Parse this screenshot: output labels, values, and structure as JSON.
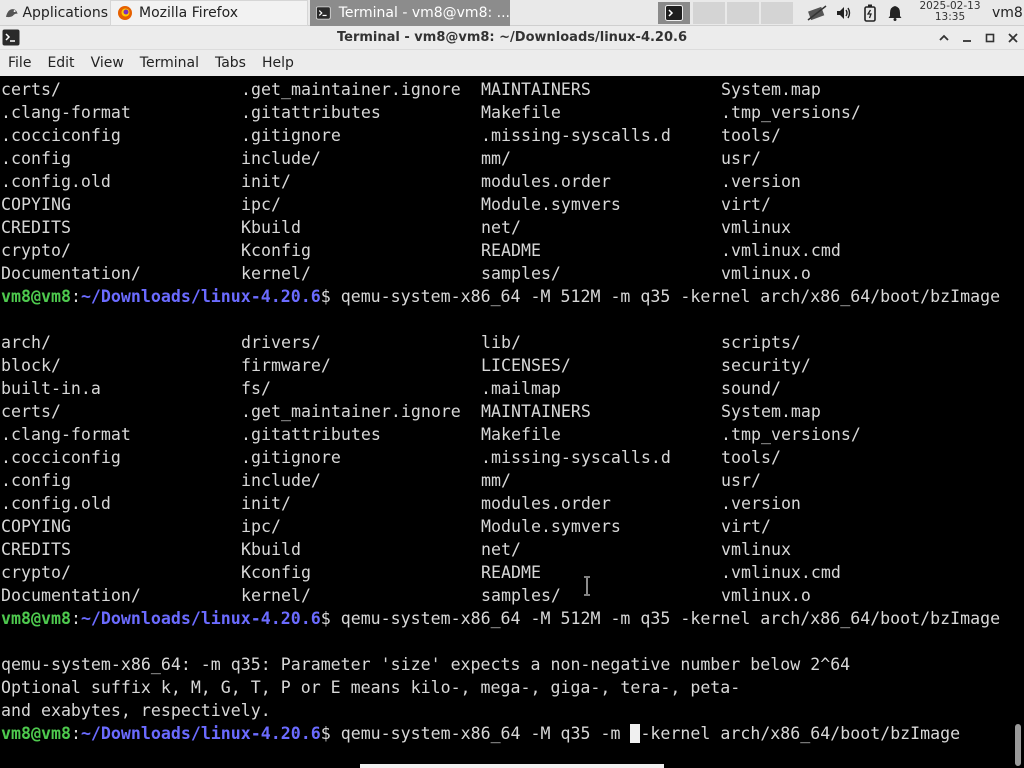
{
  "panel": {
    "applications_label": "Applications",
    "tasks": [
      {
        "label": "Mozilla Firefox",
        "icon": "firefox-icon"
      },
      {
        "label": "Terminal - vm8@vm8: ...",
        "icon": "terminal-icon"
      }
    ],
    "clock_date": "2025-02-13",
    "clock_time": "13:35",
    "user": "vm8"
  },
  "window": {
    "title": "Terminal - vm8@vm8: ~/Downloads/linux-4.20.6"
  },
  "menu": [
    "File",
    "Edit",
    "View",
    "Terminal",
    "Tabs",
    "Help"
  ],
  "prompt": {
    "user": "vm8@vm8",
    "sep": ":",
    "path": "~/Downloads/linux-4.20.6",
    "dollar": "$"
  },
  "terminal": {
    "listing_top": [
      [
        "certs/",
        ".get_maintainer.ignore",
        "MAINTAINERS",
        "System.map"
      ],
      [
        ".clang-format",
        ".gitattributes",
        "Makefile",
        ".tmp_versions/"
      ],
      [
        ".cocciconfig",
        ".gitignore",
        ".missing-syscalls.d",
        "tools/"
      ],
      [
        ".config",
        "include/",
        "mm/",
        "usr/"
      ],
      [
        ".config.old",
        "init/",
        "modules.order",
        ".version"
      ],
      [
        "COPYING",
        "ipc/",
        "Module.symvers",
        "virt/"
      ],
      [
        "CREDITS",
        "Kbuild",
        "net/",
        "vmlinux"
      ],
      [
        "crypto/",
        "Kconfig",
        "README",
        ".vmlinux.cmd"
      ],
      [
        "Documentation/",
        "kernel/",
        "samples/",
        "vmlinux.o"
      ]
    ],
    "cmd1": " qemu-system-x86_64 -M 512M -m q35 -kernel arch/x86_64/boot/bzImage",
    "listing_full": [
      [
        "arch/",
        "drivers/",
        "lib/",
        "scripts/"
      ],
      [
        "block/",
        "firmware/",
        "LICENSES/",
        "security/"
      ],
      [
        "built-in.a",
        "fs/",
        ".mailmap",
        "sound/"
      ],
      [
        "certs/",
        ".get_maintainer.ignore",
        "MAINTAINERS",
        "System.map"
      ],
      [
        ".clang-format",
        ".gitattributes",
        "Makefile",
        ".tmp_versions/"
      ],
      [
        ".cocciconfig",
        ".gitignore",
        ".missing-syscalls.d",
        "tools/"
      ],
      [
        ".config",
        "include/",
        "mm/",
        "usr/"
      ],
      [
        ".config.old",
        "init/",
        "modules.order",
        ".version"
      ],
      [
        "COPYING",
        "ipc/",
        "Module.symvers",
        "virt/"
      ],
      [
        "CREDITS",
        "Kbuild",
        "net/",
        "vmlinux"
      ],
      [
        "crypto/",
        "Kconfig",
        "README",
        ".vmlinux.cmd"
      ],
      [
        "Documentation/",
        "kernel/",
        "samples/",
        "vmlinux.o"
      ]
    ],
    "cmd2": " qemu-system-x86_64 -M 512M -m q35 -kernel arch/x86_64/boot/bzImage",
    "error_lines": [
      "qemu-system-x86_64: -m q35: Parameter 'size' expects a non-negative number below 2^64",
      "Optional suffix k, M, G, T, P or E means kilo-, mega-, giga-, tera-, peta-",
      "and exabytes, respectively."
    ],
    "cmd3_before_cursor": " qemu-system-x86_64 -M q35 -m ",
    "cmd3_after_cursor": "-kernel arch/x86_64/boot/bzImage"
  }
}
